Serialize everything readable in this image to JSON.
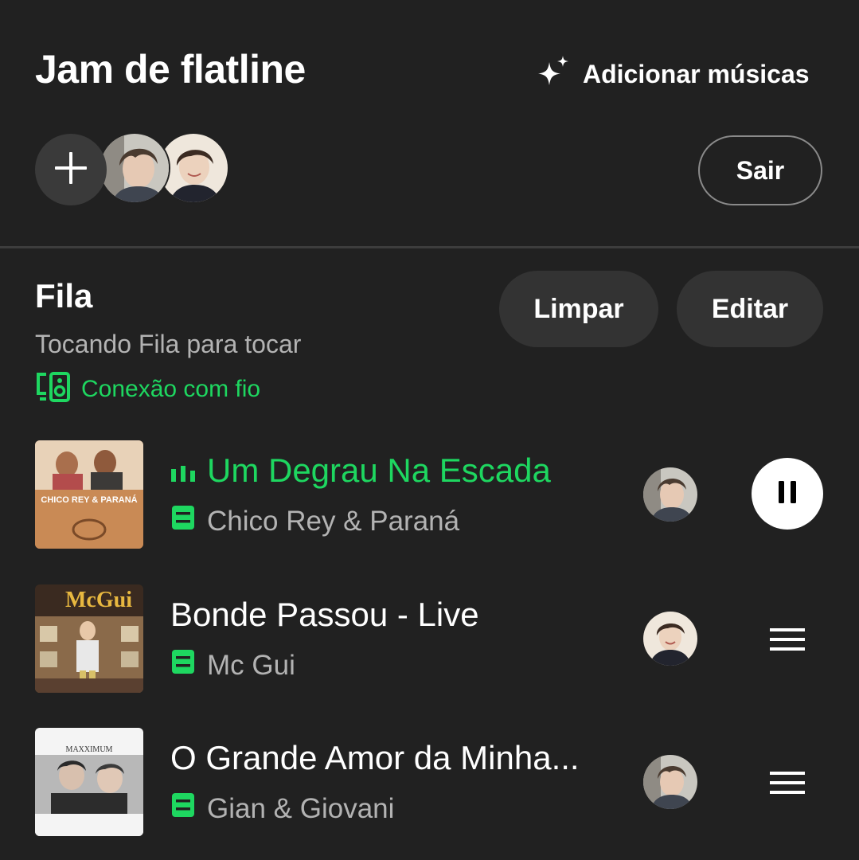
{
  "header": {
    "title": "Jam de flatline",
    "add_songs_label": "Adicionar músicas",
    "leave_label": "Sair"
  },
  "queue": {
    "title": "Fila",
    "subtitle": "Tocando Fila para tocar",
    "device_label": "Conexão com fio",
    "clear_label": "Limpar",
    "edit_label": "Editar"
  },
  "tracks": [
    {
      "title": "Um Degrau Na Escada",
      "artist": "Chico Rey & Paraná",
      "album_text": "CHICO REY & PARANÁ",
      "playing": true
    },
    {
      "title": "Bonde Passou - Live",
      "artist": "Mc Gui",
      "album_text": "McGui",
      "playing": false
    },
    {
      "title": "O Grande Amor da Minha...",
      "artist": "Gian & Giovani",
      "album_text": "MAXXIMUM",
      "playing": false
    }
  ],
  "colors": {
    "background": "#212121",
    "accent": "#1ed760",
    "secondary_text": "#b3b3b3",
    "pill": "#333333"
  },
  "icons": {
    "add_songs": "sparkle-icon",
    "add_participant": "plus-icon",
    "device": "speaker-device-icon",
    "playing": "equalizer-icon",
    "track_type": "queue-item-icon",
    "pause": "pause-icon",
    "reorder": "drag-handle-icon"
  }
}
